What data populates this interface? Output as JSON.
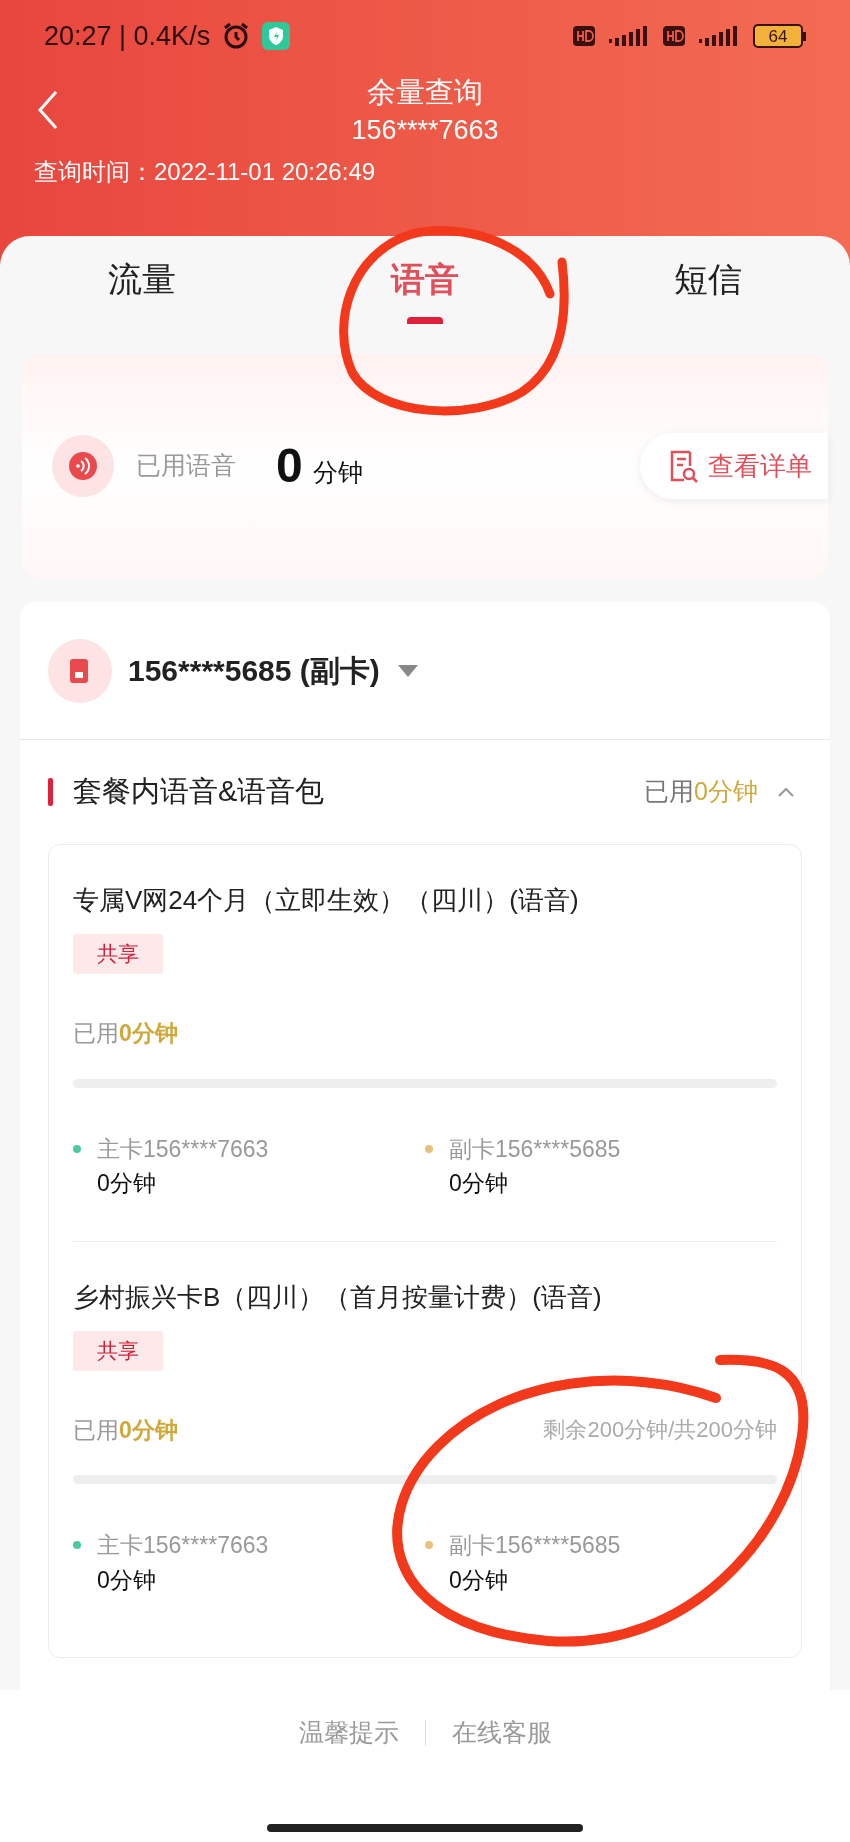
{
  "status_bar": {
    "time": "20:27 | 0.4K/s",
    "battery": "64"
  },
  "header": {
    "title": "余量查询",
    "subtitle": "156****7663",
    "query_time": "查询时间：2022-11-01 20:26:49"
  },
  "tabs": [
    {
      "label": "流量",
      "selected": false
    },
    {
      "label": "语音",
      "selected": true
    },
    {
      "label": "短信",
      "selected": false
    }
  ],
  "usage": {
    "label": "已用语音",
    "value": "0",
    "unit": "分钟",
    "detail_button": "查看详单"
  },
  "account": {
    "number": "156****5685 (副卡)"
  },
  "section": {
    "title": "套餐内语音&语音包",
    "used_prefix": "已用",
    "used_value": "0分钟",
    "expanded": true
  },
  "packages": [
    {
      "name": "专属V网24个月（立即生效）（四川）(语音)",
      "tag": "共享",
      "used_prefix": "已用",
      "used_value": "0分钟",
      "members": [
        {
          "label": "主卡156****7663",
          "value": "0分钟",
          "color": "#4cc9a0"
        },
        {
          "label": "副卡156****5685",
          "value": "0分钟",
          "color": "#e8c07a"
        }
      ]
    },
    {
      "name": "乡村振兴卡B（四川）（首月按量计费）(语音)",
      "tag": "共享",
      "used_prefix": "已用",
      "used_value": "0分钟",
      "remaining": "剩余200分钟/共200分钟",
      "members": [
        {
          "label": "主卡156****7663",
          "value": "0分钟",
          "color": "#4cc9a0"
        },
        {
          "label": "副卡156****5685",
          "value": "0分钟",
          "color": "#e8c07a"
        }
      ]
    }
  ],
  "footer": {
    "links": [
      "温馨提示",
      "在线客服"
    ]
  }
}
